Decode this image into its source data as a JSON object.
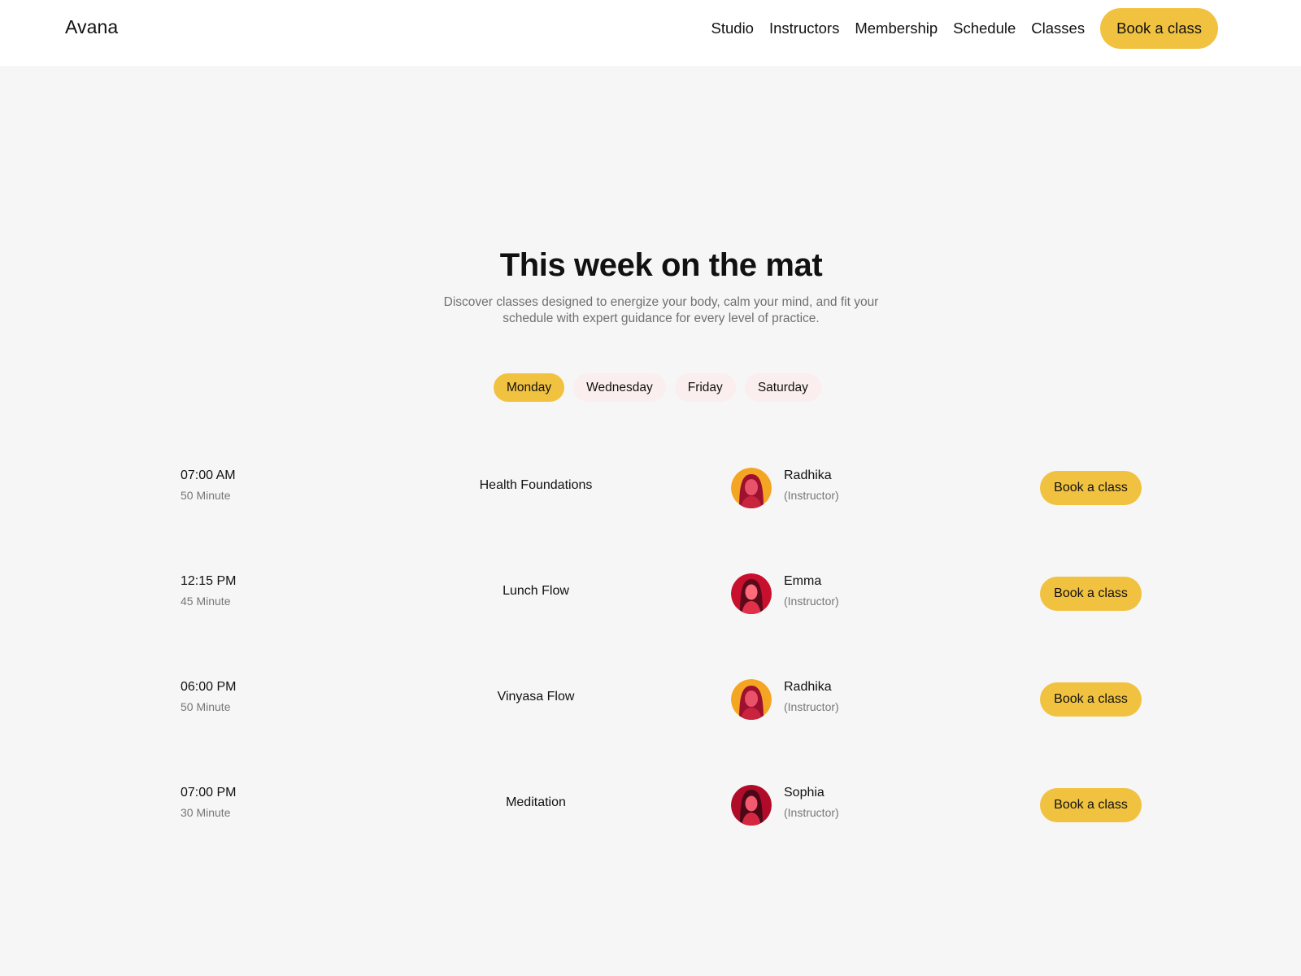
{
  "header": {
    "logo": "Avana",
    "nav": [
      "Studio",
      "Instructors",
      "Membership",
      "Schedule",
      "Classes"
    ],
    "cta_label": "Book a class"
  },
  "hero": {
    "title": "This week on the mat",
    "subtitle": "Discover classes designed to energize your body, calm your mind, and fit your schedule with expert guidance for every level of practice."
  },
  "days": {
    "tabs": [
      "Monday",
      "Wednesday",
      "Friday",
      "Saturday"
    ],
    "selected": "Monday"
  },
  "schedule": [
    {
      "time": "07:00 AM",
      "duration": "50 Minute",
      "class": "Health Foundations",
      "instructor": "Radhika",
      "role": "(Instructor)",
      "button": "Book a class"
    },
    {
      "time": "12:15 PM",
      "duration": "45 Minute",
      "class": "Lunch Flow",
      "instructor": "Emma",
      "role": "(Instructor)",
      "button": "Book a class"
    },
    {
      "time": "06:00 PM",
      "duration": "50 Minute",
      "class": "Vinyasa Flow",
      "instructor": "Radhika",
      "role": "(Instructor)",
      "button": "Book a class"
    },
    {
      "time": "07:00 PM",
      "duration": "30 Minute",
      "class": "Meditation",
      "instructor": "Sophia",
      "role": "(Instructor)",
      "button": "Book a class"
    }
  ],
  "colors": {
    "accent": "#f1c240",
    "background": "#f6f6f6",
    "tab_inactive": "#fbeeee",
    "avatar_warm": "#f4a623",
    "avatar_rose": "#c8102e"
  }
}
